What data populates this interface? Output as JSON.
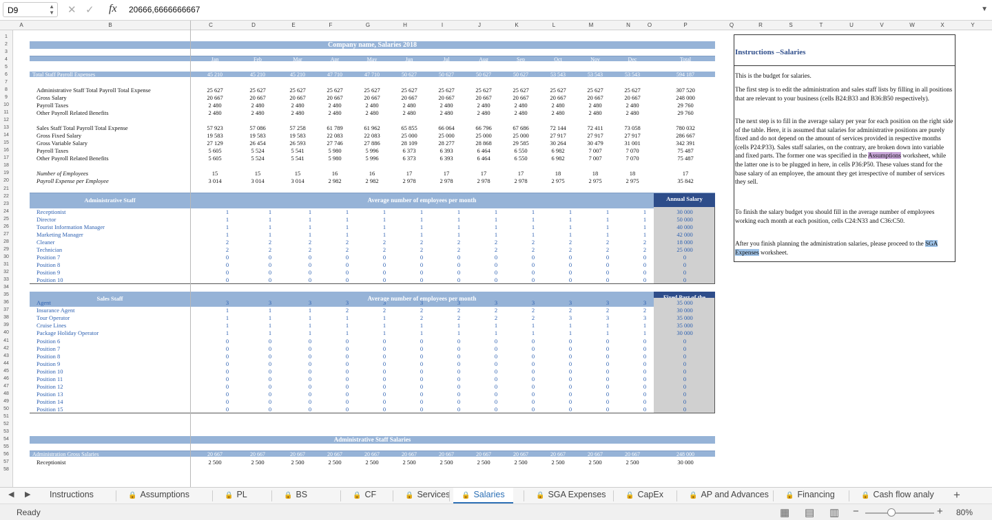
{
  "cell_ref": "D9",
  "formula_value": "20666,6666666667",
  "column_letters": [
    "A",
    "B",
    "C",
    "D",
    "E",
    "F",
    "G",
    "H",
    "I",
    "J",
    "K",
    "L",
    "M",
    "N",
    "O",
    "P",
    "Q",
    "R",
    "S",
    "T",
    "U",
    "V",
    "W",
    "X",
    "Y"
  ],
  "months": [
    "Jan",
    "Feb",
    "Mar",
    "Apr",
    "May",
    "Jun",
    "Jul",
    "Aug",
    "Sep",
    "Oct",
    "Nov",
    "Dec"
  ],
  "total_label": "Total",
  "title": "Company name, Salaries 2018",
  "summary": {
    "total_payroll": {
      "label": "Total Staff Payroll Expenses",
      "values": [
        "45 210",
        "45 210",
        "45 210",
        "47 710",
        "47 710",
        "50 627",
        "50 627",
        "50 627",
        "50 627",
        "53 543",
        "53 543",
        "53 543"
      ],
      "total": "594 187"
    },
    "rows": [
      {
        "label": "Administrative Staff Total Payroll Total Expense",
        "values": [
          "25 627",
          "25 627",
          "25 627",
          "25 627",
          "25 627",
          "25 627",
          "25 627",
          "25 627",
          "25 627",
          "25 627",
          "25 627",
          "25 627"
        ],
        "total": "307 520"
      },
      {
        "label": "Gross Salary",
        "values": [
          "20 667",
          "20 667",
          "20 667",
          "20 667",
          "20 667",
          "20 667",
          "20 667",
          "20 667",
          "20 667",
          "20 667",
          "20 667",
          "20 667"
        ],
        "total": "248 000"
      },
      {
        "label": "Payroll Taxes",
        "values": [
          "2 480",
          "2 480",
          "2 480",
          "2 480",
          "2 480",
          "2 480",
          "2 480",
          "2 480",
          "2 480",
          "2 480",
          "2 480",
          "2 480"
        ],
        "total": "29 760"
      },
      {
        "label": "Other Payroll Related Benefits",
        "values": [
          "2 480",
          "2 480",
          "2 480",
          "2 480",
          "2 480",
          "2 480",
          "2 480",
          "2 480",
          "2 480",
          "2 480",
          "2 480",
          "2 480"
        ],
        "total": "29 760"
      },
      {
        "label": "Sales Staff Total Payroll Total Expense",
        "values": [
          "57 923",
          "57 086",
          "57 258",
          "61 789",
          "61 962",
          "65 855",
          "66 064",
          "66 796",
          "67 686",
          "72 144",
          "72 411",
          "73 058"
        ],
        "total": "780 032"
      },
      {
        "label": "Gross Fixed Salary",
        "values": [
          "19 583",
          "19 583",
          "19 583",
          "22 083",
          "22 083",
          "25 000",
          "25 000",
          "25 000",
          "25 000",
          "27 917",
          "27 917",
          "27 917"
        ],
        "total": "286 667"
      },
      {
        "label": "Gross Variable Salary",
        "values": [
          "27 129",
          "26 454",
          "26 593",
          "27 746",
          "27 886",
          "28 109",
          "28 277",
          "28 868",
          "29 585",
          "30 264",
          "30 479",
          "31 001"
        ],
        "total": "342 391"
      },
      {
        "label": "Payroll Taxes",
        "values": [
          "5 605",
          "5 524",
          "5 541",
          "5 980",
          "5 996",
          "6 373",
          "6 393",
          "6 464",
          "6 550",
          "6 982",
          "7 007",
          "7 070"
        ],
        "total": "75 487"
      },
      {
        "label": "Other Payroll Related Benefits",
        "values": [
          "5 605",
          "5 524",
          "5 541",
          "5 980",
          "5 996",
          "6 373",
          "6 393",
          "6 464",
          "6 550",
          "6 982",
          "7 007",
          "7 070"
        ],
        "total": "75 487"
      },
      {
        "label": "Number of Employees",
        "values": [
          "15",
          "15",
          "15",
          "16",
          "16",
          "17",
          "17",
          "17",
          "17",
          "18",
          "18",
          "18"
        ],
        "total": "17"
      },
      {
        "label": "Payroll Expense per Employee",
        "values": [
          "3 014",
          "3 014",
          "3 014",
          "2 982",
          "2 982",
          "2 978",
          "2 978",
          "2 978",
          "2 978",
          "2 975",
          "2 975",
          "2 975"
        ],
        "total": "35 842"
      }
    ]
  },
  "admin_staff": {
    "header": "Administrative Staff",
    "avg_header": "Average number of employees per month",
    "annual_header": "Annual Salary",
    "rows": [
      {
        "label": "Receptionist",
        "values": [
          "1",
          "1",
          "1",
          "1",
          "1",
          "1",
          "1",
          "1",
          "1",
          "1",
          "1",
          "1"
        ],
        "annual": "30 000"
      },
      {
        "label": "Director",
        "values": [
          "1",
          "1",
          "1",
          "1",
          "1",
          "1",
          "1",
          "1",
          "1",
          "1",
          "1",
          "1"
        ],
        "annual": "50 000"
      },
      {
        "label": "Tourist Information Manager",
        "values": [
          "1",
          "1",
          "1",
          "1",
          "1",
          "1",
          "1",
          "1",
          "1",
          "1",
          "1",
          "1"
        ],
        "annual": "40 000"
      },
      {
        "label": "Marketing Manager",
        "values": [
          "1",
          "1",
          "1",
          "1",
          "1",
          "1",
          "1",
          "1",
          "1",
          "1",
          "1",
          "1"
        ],
        "annual": "42 000"
      },
      {
        "label": "Cleaner",
        "values": [
          "2",
          "2",
          "2",
          "2",
          "2",
          "2",
          "2",
          "2",
          "2",
          "2",
          "2",
          "2"
        ],
        "annual": "18 000"
      },
      {
        "label": "Technician",
        "values": [
          "2",
          "2",
          "2",
          "2",
          "2",
          "2",
          "2",
          "2",
          "2",
          "2",
          "2",
          "2"
        ],
        "annual": "25 000"
      },
      {
        "label": "Position 7",
        "values": [
          "0",
          "0",
          "0",
          "0",
          "0",
          "0",
          "0",
          "0",
          "0",
          "0",
          "0",
          "0"
        ],
        "annual": "0"
      },
      {
        "label": "Position 8",
        "values": [
          "0",
          "0",
          "0",
          "0",
          "0",
          "0",
          "0",
          "0",
          "0",
          "0",
          "0",
          "0"
        ],
        "annual": "0"
      },
      {
        "label": "Position 9",
        "values": [
          "0",
          "0",
          "0",
          "0",
          "0",
          "0",
          "0",
          "0",
          "0",
          "0",
          "0",
          "0"
        ],
        "annual": "0"
      },
      {
        "label": "Position 10",
        "values": [
          "0",
          "0",
          "0",
          "0",
          "0",
          "0",
          "0",
          "0",
          "0",
          "0",
          "0",
          "0"
        ],
        "annual": "0"
      }
    ]
  },
  "sales_staff": {
    "header": "Sales Staff",
    "avg_header": "Average number of employees per month",
    "annual_header": "Fixed Part of the Annual Salary",
    "rows": [
      {
        "label": "Agent",
        "values": [
          "3",
          "3",
          "3",
          "3",
          "3",
          "3",
          "3",
          "3",
          "3",
          "3",
          "3",
          "3"
        ],
        "annual": "35 000"
      },
      {
        "label": "Insurance Agent",
        "values": [
          "1",
          "1",
          "1",
          "2",
          "2",
          "2",
          "2",
          "2",
          "2",
          "2",
          "2",
          "2"
        ],
        "annual": "30 000"
      },
      {
        "label": "Tour Operator",
        "values": [
          "1",
          "1",
          "1",
          "1",
          "1",
          "2",
          "2",
          "2",
          "2",
          "3",
          "3",
          "3"
        ],
        "annual": "35 000"
      },
      {
        "label": "Cruise Lines",
        "values": [
          "1",
          "1",
          "1",
          "1",
          "1",
          "1",
          "1",
          "1",
          "1",
          "1",
          "1",
          "1"
        ],
        "annual": "35 000"
      },
      {
        "label": "Package Holiday Operator",
        "values": [
          "1",
          "1",
          "1",
          "1",
          "1",
          "1",
          "1",
          "1",
          "1",
          "1",
          "1",
          "1"
        ],
        "annual": "30 000"
      },
      {
        "label": "Position 6",
        "values": [
          "0",
          "0",
          "0",
          "0",
          "0",
          "0",
          "0",
          "0",
          "0",
          "0",
          "0",
          "0"
        ],
        "annual": "0"
      },
      {
        "label": "Position 7",
        "values": [
          "0",
          "0",
          "0",
          "0",
          "0",
          "0",
          "0",
          "0",
          "0",
          "0",
          "0",
          "0"
        ],
        "annual": "0"
      },
      {
        "label": "Position 8",
        "values": [
          "0",
          "0",
          "0",
          "0",
          "0",
          "0",
          "0",
          "0",
          "0",
          "0",
          "0",
          "0"
        ],
        "annual": "0"
      },
      {
        "label": "Position 9",
        "values": [
          "0",
          "0",
          "0",
          "0",
          "0",
          "0",
          "0",
          "0",
          "0",
          "0",
          "0",
          "0"
        ],
        "annual": "0"
      },
      {
        "label": "Position 10",
        "values": [
          "0",
          "0",
          "0",
          "0",
          "0",
          "0",
          "0",
          "0",
          "0",
          "0",
          "0",
          "0"
        ],
        "annual": "0"
      },
      {
        "label": "Position 11",
        "values": [
          "0",
          "0",
          "0",
          "0",
          "0",
          "0",
          "0",
          "0",
          "0",
          "0",
          "0",
          "0"
        ],
        "annual": "0"
      },
      {
        "label": "Position 12",
        "values": [
          "0",
          "0",
          "0",
          "0",
          "0",
          "0",
          "0",
          "0",
          "0",
          "0",
          "0",
          "0"
        ],
        "annual": "0"
      },
      {
        "label": "Position 13",
        "values": [
          "0",
          "0",
          "0",
          "0",
          "0",
          "0",
          "0",
          "0",
          "0",
          "0",
          "0",
          "0"
        ],
        "annual": "0"
      },
      {
        "label": "Position 14",
        "values": [
          "0",
          "0",
          "0",
          "0",
          "0",
          "0",
          "0",
          "0",
          "0",
          "0",
          "0",
          "0"
        ],
        "annual": "0"
      },
      {
        "label": "Position 15",
        "values": [
          "0",
          "0",
          "0",
          "0",
          "0",
          "0",
          "0",
          "0",
          "0",
          "0",
          "0",
          "0"
        ],
        "annual": "0"
      }
    ]
  },
  "admin_salaries": {
    "header": "Administrative Staff Salaries",
    "gross": {
      "label": "Administration Gross Salaries",
      "values": [
        "20 667",
        "20 667",
        "20 667",
        "20 667",
        "20 667",
        "20 667",
        "20 667",
        "20 667",
        "20 667",
        "20 667",
        "20 667",
        "20 667"
      ],
      "total": "248 000"
    },
    "receptionist": {
      "label": "Receptionist",
      "values": [
        "2 500",
        "2 500",
        "2 500",
        "2 500",
        "2 500",
        "2 500",
        "2 500",
        "2 500",
        "2 500",
        "2 500",
        "2 500",
        "2 500"
      ],
      "total": "30 000"
    }
  },
  "instructions": {
    "title": "Instructions –Salaries",
    "p1": "This is the budget for salaries.",
    "p2": "The first step is to edit the administration and sales staff lists by filling in all positions that are relevant to your business (cells B24:B33 and B36:B50 respectively).",
    "p3a": "The next step is to fill in the average salary per year for each position on the right side of the table. Here, it is assumed that salaries for administrative positions are purely fixed and do not depend on the amount of services provided in respective months (cells P24:P33). Sales staff salaries, on the contrary, are broken down into variable and fixed parts. The former one was specified in the ",
    "p3link": "Assumptions",
    "p3b": " worksheet, while the latter one is to be plugged in here, in cells P36:P50. These values stand for the base salary of an employee, the amount they get irrespective of number of services they sell.",
    "p4": "To finish the salary budget you should fill in the average number of employees working each month at each position, cells C24:N33 and C36:C50.",
    "p5a": "After you finish planning the administration salaries, please proceed to the ",
    "p5link": "SGA Expenses",
    "p5b": " worksheet."
  },
  "tabs": [
    "Instructions",
    "Assumptions",
    "PL",
    "BS",
    "CF",
    "Services",
    "Salaries",
    "SGA Expenses",
    "CapEx",
    "AP and Advances",
    "Financing",
    "Cash flow analy"
  ],
  "active_tab": "Salaries",
  "status": {
    "ready": "Ready",
    "zoom": "80%"
  }
}
